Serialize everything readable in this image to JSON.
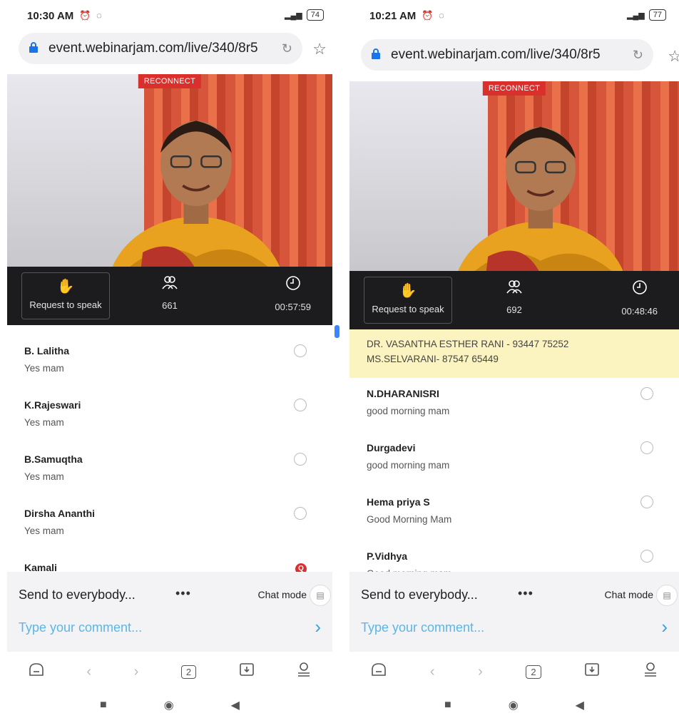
{
  "screens": [
    {
      "status": {
        "time": "10:30 AM",
        "battery": "74"
      },
      "url": "event.webinarjam.com/live/340/8r5",
      "reconnect_label": "RECONNECT",
      "controls": {
        "request_label": "Request to speak",
        "viewers": "661",
        "timer": "00:57:59"
      },
      "notice": [],
      "messages": [
        {
          "name": "B. Lalitha",
          "text": "Yes mam"
        },
        {
          "name": "K.Rajeswari",
          "text": "Yes mam"
        },
        {
          "name": "B.Samuqtha",
          "text": "Yes mam"
        },
        {
          "name": "Dirsha Ananthi",
          "text": "Yes mam"
        },
        {
          "name": "Kamali",
          "text": "",
          "badge": "Q"
        }
      ],
      "composer": {
        "send_to": "Send to everybody...",
        "chat_mode": "Chat mode",
        "placeholder": "Type your comment..."
      },
      "tab_count": "2"
    },
    {
      "status": {
        "time": "10:21 AM",
        "battery": "77"
      },
      "url": "event.webinarjam.com/live/340/8r5",
      "reconnect_label": "RECONNECT",
      "controls": {
        "request_label": "Request to speak",
        "viewers": "692",
        "timer": "00:48:46"
      },
      "notice": [
        "DR. VASANTHA ESTHER RANI - 93447 75252",
        "MS.SELVARANI- 87547 65449"
      ],
      "messages": [
        {
          "name": "N.DHARANISRI",
          "text": "good morning mam"
        },
        {
          "name": "Durgadevi",
          "text": "good morning mam"
        },
        {
          "name": "Hema priya S",
          "text": "Good Morning Mam"
        },
        {
          "name": "P.Vidhya",
          "text": "Good morning mam"
        }
      ],
      "composer": {
        "send_to": "Send to everybody...",
        "chat_mode": "Chat mode",
        "placeholder": "Type your comment..."
      },
      "tab_count": "2"
    }
  ],
  "colors": {
    "accent": "#3aa0e0",
    "reconnect": "#d9302d",
    "notice_bg": "#fbf3c0"
  },
  "icons": [
    "lock-icon",
    "reload-icon",
    "star-icon",
    "raise-hand-icon",
    "viewers-icon",
    "clock-icon",
    "send-icon",
    "home-icon",
    "back-icon",
    "forward-icon",
    "download-icon",
    "profile-icon"
  ]
}
